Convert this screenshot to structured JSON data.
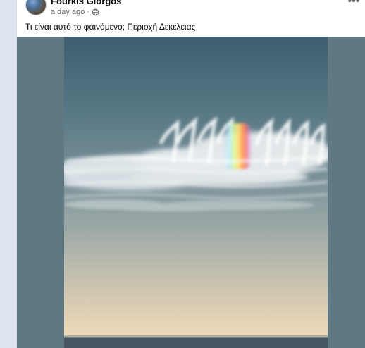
{
  "post": {
    "author": "Fourkis Giorgos",
    "timestamp": "a day ago",
    "separator": "·",
    "privacy_icon": "globe-icon",
    "more_icon": "more-horizontal-icon",
    "text": "Τι είναι αυτό το φαινόμενο; Περιοχή Δεκελειας"
  },
  "media": {
    "type": "photo"
  },
  "colors": {
    "page_background": "#e9ebee",
    "card_background": "#ffffff",
    "secondary_text": "#65676b",
    "photo_side_fill": "#5f7882"
  }
}
